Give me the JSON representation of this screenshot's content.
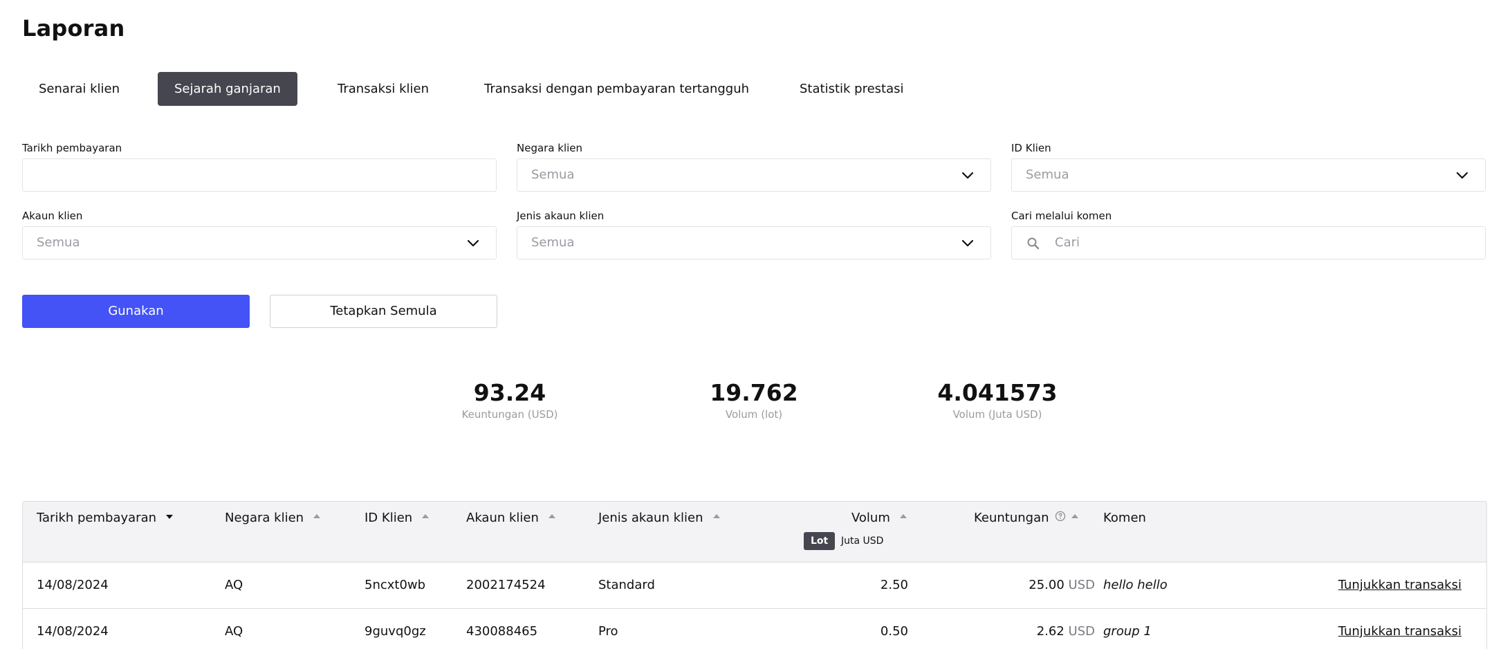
{
  "page": {
    "title": "Laporan"
  },
  "tabs": [
    {
      "label": "Senarai klien"
    },
    {
      "label": "Sejarah ganjaran",
      "active": true
    },
    {
      "label": "Transaksi klien"
    },
    {
      "label": "Transaksi dengan pembayaran tertangguh"
    },
    {
      "label": "Statistik prestasi"
    }
  ],
  "filters": {
    "payment_date": {
      "label": "Tarikh pembayaran",
      "value": ""
    },
    "client_country": {
      "label": "Negara klien",
      "placeholder": "Semua"
    },
    "client_id": {
      "label": "ID Klien",
      "placeholder": "Semua"
    },
    "client_account": {
      "label": "Akaun klien",
      "placeholder": "Semua"
    },
    "account_type": {
      "label": "Jenis akaun klien",
      "placeholder": "Semua"
    },
    "comment_search": {
      "label": "Cari melalui komen",
      "placeholder": "Cari"
    }
  },
  "buttons": {
    "apply": "Gunakan",
    "reset": "Tetapkan Semula"
  },
  "stats": [
    {
      "value": "93.24",
      "label": "Keuntungan (USD)"
    },
    {
      "value": "19.762",
      "label": "Volum (lot)"
    },
    {
      "value": "4.041573",
      "label": "Volum (Juta USD)"
    }
  ],
  "table": {
    "columns": {
      "payment_date": "Tarikh pembayaran",
      "client_country": "Negara klien",
      "client_id": "ID Klien",
      "client_account": "Akaun klien",
      "account_type": "Jenis akaun klien",
      "volume": "Volum",
      "profit": "Keuntungan",
      "comment": "Komen"
    },
    "volume_units": {
      "lot": "Lot",
      "million_usd": "Juta USD",
      "selected": "Lot"
    },
    "rows": [
      {
        "date": "14/08/2024",
        "country": "AQ",
        "client_id": "5ncxt0wb",
        "account": "2002174524",
        "type": "Standard",
        "volume": "2.50",
        "profit": "25.00",
        "currency": "USD",
        "comment": "hello hello",
        "action": "Tunjukkan transaksi"
      },
      {
        "date": "14/08/2024",
        "country": "AQ",
        "client_id": "9guvq0gz",
        "account": "430088465",
        "type": "Pro",
        "volume": "0.50",
        "profit": "2.62",
        "currency": "USD",
        "comment": "group 1",
        "action": "Tunjukkan transaksi"
      }
    ]
  },
  "colors": {
    "primary": "#4353f5",
    "active_tab": "#464650",
    "muted_text": "#9a9aa2",
    "border": "#dcdce2",
    "header_bg": "#f3f3f5"
  },
  "icons": {
    "dropdown": "chevron-down-icon",
    "search": "search-icon",
    "help": "help-circle-icon",
    "sort_asc": "sort-asc-icon",
    "sort_desc": "sort-desc-icon"
  }
}
